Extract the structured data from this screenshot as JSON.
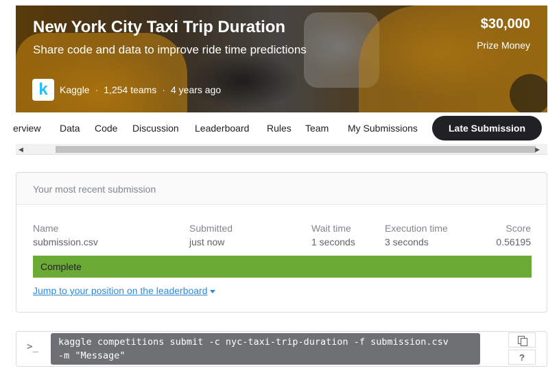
{
  "header": {
    "title": "New York City Taxi Trip Duration",
    "subtitle": "Share code and data to improve ride time predictions",
    "prize_amount": "$30,000",
    "prize_label": "Prize Money",
    "logo_letter": "k",
    "host": "Kaggle",
    "separator": "·",
    "teams": "1,254 teams",
    "age": "4 years ago"
  },
  "tabs": {
    "overview": "erview",
    "data": "Data",
    "code": "Code",
    "discussion": "Discussion",
    "leaderboard": "Leaderboard",
    "rules": "Rules",
    "team": "Team",
    "my_submissions": "My Submissions",
    "late_submission": "Late Submission"
  },
  "scrollbar": {
    "left_arrow": "◀",
    "right_arrow": "▶"
  },
  "submission": {
    "heading": "Your most recent submission",
    "columns": {
      "name_label": "Name",
      "name_value": "submission.csv",
      "submitted_label": "Submitted",
      "submitted_value": "just now",
      "wait_label": "Wait time",
      "wait_value": "1 seconds",
      "exec_label": "Execution time",
      "exec_value": "3 seconds",
      "score_label": "Score",
      "score_value": "0.56195"
    },
    "status": "Complete",
    "status_color": "#6aaa35",
    "jump_link": "Jump to your position on the leaderboard"
  },
  "command": {
    "prompt_icon": ">_",
    "text": "kaggle competitions submit -c nyc-taxi-trip-duration -f submission.csv\n-m \"Message\"",
    "help_label": "?"
  },
  "colors": {
    "accent": "#20beff",
    "dark_button": "#202124",
    "link": "#2e8ad8"
  }
}
